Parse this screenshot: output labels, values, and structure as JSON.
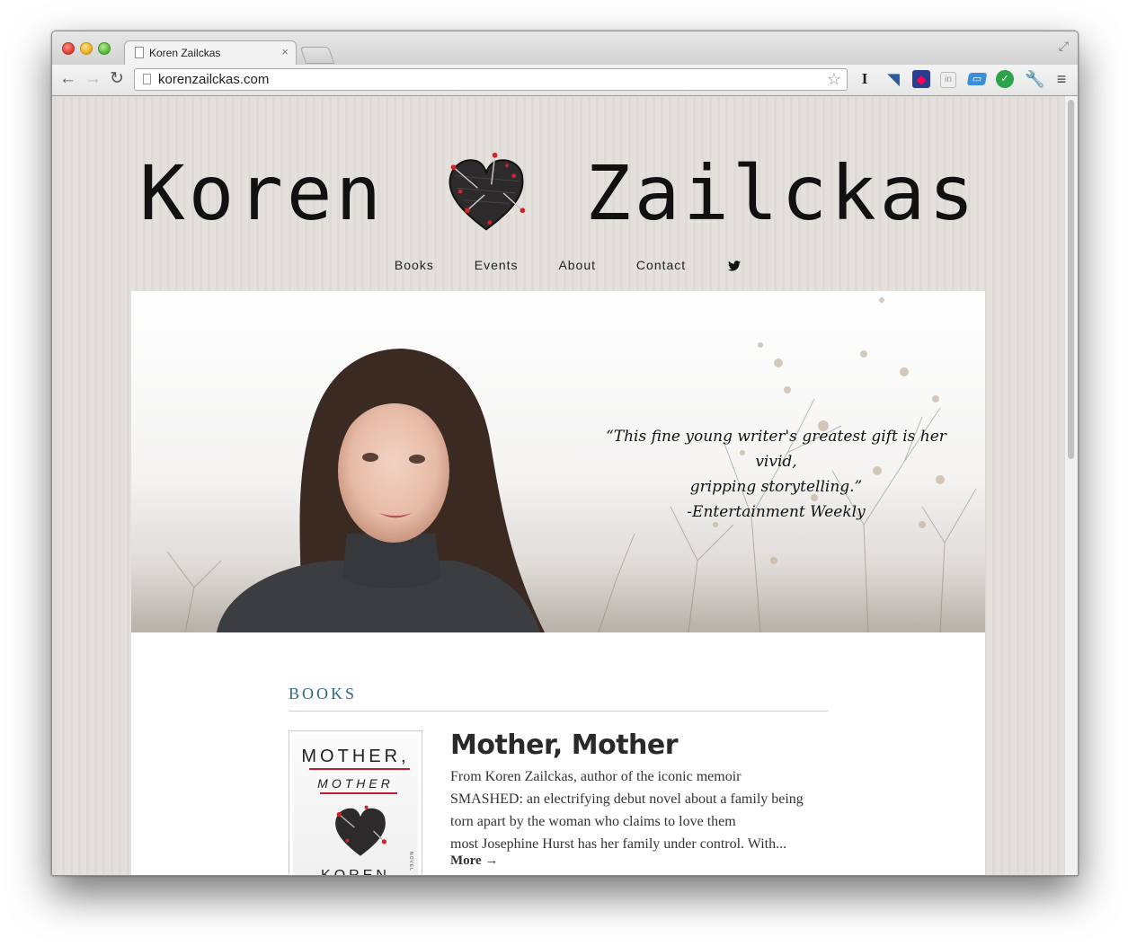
{
  "browser": {
    "tab_title": "Koren Zailckas",
    "tab_close": "×",
    "url": "korenzailckas.com"
  },
  "site": {
    "title_left": "Koren",
    "title_right": "Zailckas",
    "nav": [
      "Books",
      "Events",
      "About",
      "Contact"
    ]
  },
  "hero": {
    "quote_line1": "“This fine young writer's greatest gift is her vivid,",
    "quote_line2": "gripping storytelling.”",
    "quote_source": "-Entertainment Weekly"
  },
  "books": {
    "heading": "BOOKS",
    "items": [
      {
        "title": "Mother, Mother",
        "description_lines": [
          "From Koren Zailckas, author of the iconic memoir",
          "SMASHED: an electrifying debut novel about a family being",
          "torn apart by the woman who claims to love them",
          "most Josephine Hurst has her family under control. With..."
        ],
        "more_label": "More →",
        "cover": {
          "line1": "MOTHER,",
          "line2": "MOTHER",
          "author": "KOREN",
          "side": "NOVEL"
        }
      }
    ]
  },
  "colors": {
    "heading_accent": "#2e6a80",
    "cover_red": "#c01d2c",
    "page_background": "#e3dfda"
  },
  "icons": [
    "back-arrow-icon",
    "forward-arrow-icon",
    "reload-icon",
    "star-icon",
    "twitter-icon",
    "heart-icon",
    "wrench-icon",
    "menu-icon"
  ]
}
